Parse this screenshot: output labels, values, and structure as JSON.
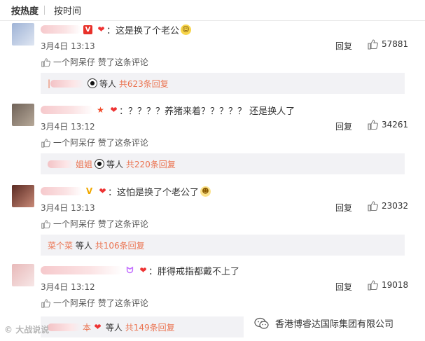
{
  "sort_bar": {
    "hot_label": "按热度",
    "time_label": "按时间"
  },
  "comments": [
    {
      "text": "：这是换了个老公",
      "date": "3月4日 13:13",
      "reply_label": "回复",
      "likes": "57881",
      "liker": "一个阿呆仔",
      "liked_suffix": "赞了这条评论",
      "reply_box": {
        "name_tail": "",
        "etc": "等人",
        "total": "共623条回复"
      }
    },
    {
      "text": "：？？？？养猪来着？？？？？ 还是换人了",
      "date": "3月4日 13:12",
      "reply_label": "回复",
      "likes": "34261",
      "liker": "一个阿呆仔",
      "liked_suffix": "赞了这条评论",
      "reply_box": {
        "name_tail": "姐姐",
        "etc": "等人",
        "total": "共220条回复"
      }
    },
    {
      "text": "：这怕是换了个老公了",
      "date": "3月4日 13:13",
      "reply_label": "回复",
      "likes": "23032",
      "liker": "一个阿呆仔",
      "liked_suffix": "赞了这条评论",
      "reply_box": {
        "name": "菜个菜",
        "etc": "等人",
        "total": "共106条回复"
      }
    },
    {
      "text": "：胖得戒指都戴不上了",
      "date": "3月4日 13:12",
      "reply_label": "回复",
      "likes": "19018",
      "liker": "一个阿呆仔",
      "liked_suffix": "赞了这条评论",
      "reply_box": {
        "name_tail": "本",
        "etc": "等人",
        "total": "共149条回复"
      }
    }
  ],
  "watermarks": {
    "left": "大战说说",
    "right": "香港博睿达国际集团有限公司"
  },
  "colors": {
    "accent_orange": "#eb7350",
    "reply_box_bg": "#f2f2f5",
    "v_badge": "#e8312a"
  }
}
